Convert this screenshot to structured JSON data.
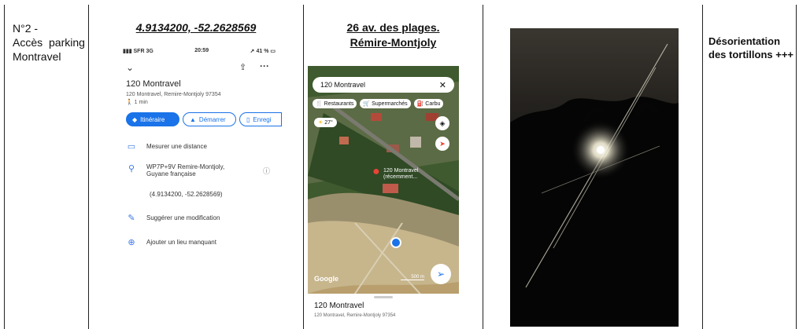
{
  "row": {
    "number": "N°2 -",
    "location_line1": "Accès  parking",
    "location_line2": "Montravel",
    "coords_title": "4.9134200, -52.2628569",
    "address_title_line1": "26 av. des plages.",
    "address_title_line2": "Rémire-Montjoly",
    "remark_line1": "Désorientation",
    "remark_line2": "des tortillons +++"
  },
  "phone": {
    "carrier": "SFR  3G",
    "time": "20:59",
    "battery": "41 %",
    "place_name": "120 Montravel",
    "place_address": "120 Montravel, Remire-Montjoly 97354",
    "walk_time": "1 min",
    "btn_itinerary": "Itinéraire",
    "btn_start": "Démarrer",
    "btn_save": "Enregi",
    "measure": "Mesurer une distance",
    "pluscode_line1": "WP7P+9V Remire-Montjoly,",
    "pluscode_line2": "Guyane française",
    "coordinates": "(4.9134200, -52.2628569)",
    "suggest": "Suggérer une modification",
    "add_place": "Ajouter un lieu manquant"
  },
  "map": {
    "search_text": "120 Montravel",
    "chip_restaurants": "Restaurants",
    "chip_supermarkets": "Supermarchés",
    "chip_fuel": "Carbu",
    "temperature": "27°",
    "pin_label_line1": "120 Montravel",
    "pin_label_line2": "(récemment...",
    "google": "Google",
    "scale": "500 m",
    "sheet_title": "120 Montravel",
    "sheet_sub": "120 Montravel, Remire-Montjoly 97354"
  },
  "colors": {
    "accent": "#1a73e8",
    "pin": "#ea4335"
  }
}
